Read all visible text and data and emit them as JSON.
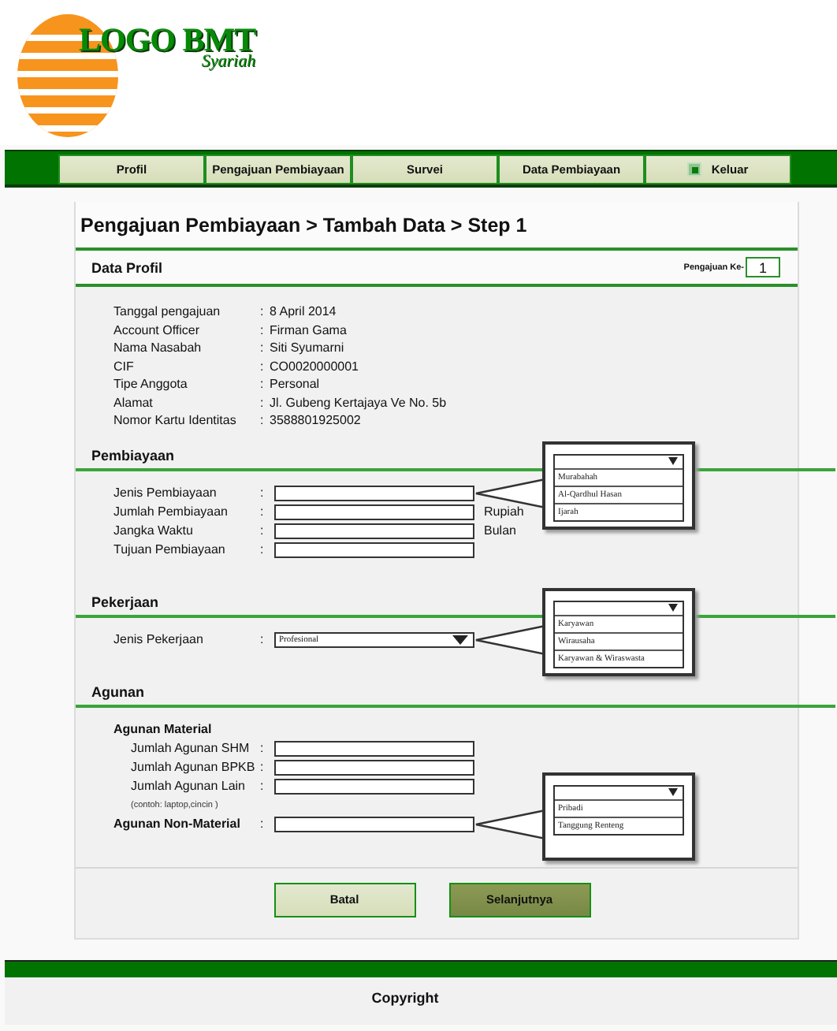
{
  "logo": {
    "title": "LOGO BMT",
    "subtitle": "Syariah"
  },
  "nav": [
    {
      "label": "Profil",
      "kind": "link"
    },
    {
      "label": "Pengajuan Pembiayaan",
      "kind": "link"
    },
    {
      "label": "Survei",
      "kind": "link"
    },
    {
      "label": "Data Pembiayaan",
      "kind": "link"
    },
    {
      "label": "Keluar",
      "kind": "exit"
    }
  ],
  "page_title": "Pengajuan Pembiayaan > Tambah Data > Step 1",
  "profile": {
    "title": "Data Profil",
    "counter_label": "Pengajuan Ke-",
    "counter_value": "1",
    "rows": [
      {
        "label": "Tanggal pengajuan",
        "separator": ":",
        "value": "8 April 2014"
      },
      {
        "label": "Account Officer",
        "separator": ":",
        "value": "Firman Gama"
      },
      {
        "label": "Nama Nasabah",
        "separator": ":",
        "value": "Siti Syumarni"
      },
      {
        "label": "CIF",
        "separator": ":",
        "value": "CO0020000001"
      },
      {
        "label": "Tipe Anggota",
        "separator": ":",
        "value": "Personal"
      },
      {
        "label": "Alamat",
        "separator": ":",
        "value": "Jl. Gubeng Kertajaya Ve No. 5b"
      },
      {
        "label": "Nomor Kartu Identitas",
        "separator": ":",
        "value": "3588801925002"
      }
    ]
  },
  "sections": [
    {
      "title": "Pembiayaan",
      "fields": [
        {
          "kind": "input",
          "label": "Jenis Pembiayaan",
          "separator": ":",
          "callout": {
            "options": [
              "Murabahah",
              "Al-Qardhul Hasan",
              "Ijarah"
            ]
          }
        },
        {
          "kind": "input",
          "label": "Jumlah Pembiayaan",
          "separator": ":",
          "unit": "Rupiah"
        },
        {
          "kind": "input",
          "label": "Jangka Waktu",
          "separator": ":",
          "unit": "Bulan"
        },
        {
          "kind": "input",
          "label": "Tujuan Pembiayaan",
          "separator": ":"
        }
      ]
    },
    {
      "title": "Pekerjaan",
      "fields": [
        {
          "kind": "select",
          "label": "Jenis Pekerjaan",
          "separator": ":",
          "value": "Profesional",
          "callout": {
            "options": [
              "Karyawan",
              "Wirausaha",
              "Karyawan & Wiraswasta"
            ]
          }
        }
      ]
    },
    {
      "title": "Agunan",
      "fields": [
        {
          "kind": "heading",
          "label": "Agunan Material"
        },
        {
          "kind": "sub-input",
          "label": "Jumlah Agunan SHM",
          "separator": ":"
        },
        {
          "kind": "sub-input",
          "label": "Jumlah Agunan BPKB",
          "separator": ":"
        },
        {
          "kind": "sub-input",
          "label": "Jumlah Agunan Lain",
          "separator": ":"
        },
        {
          "kind": "note",
          "label": "(contoh: laptop,cincin )"
        },
        {
          "kind": "strong-input",
          "label": "Agunan Non-Material",
          "separator": ":",
          "callout": {
            "options": [
              "Pribadi",
              "Tanggung Renteng"
            ]
          }
        }
      ]
    }
  ],
  "buttons": [
    {
      "label": "Batal",
      "kind": "secondary"
    },
    {
      "label": "Selanjutnya",
      "kind": "primary"
    }
  ],
  "footer": "Copyright"
}
